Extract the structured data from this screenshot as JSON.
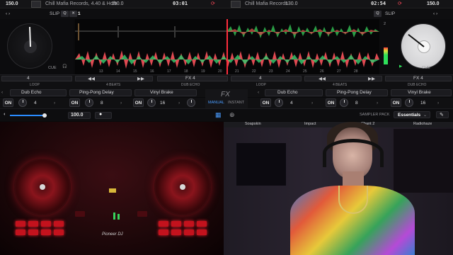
{
  "top_bar": {
    "deck_a": {
      "bpm": "150.0",
      "artist": "Chill Mafia Records, 4.40 & Hofe",
      "key_bpm": "150.0",
      "time": "03:01"
    },
    "deck_b": {
      "bpm": "150.0",
      "artist": "Chill Mafia Records",
      "key_bpm": "130.0",
      "time": "02:54"
    }
  },
  "deck_a": {
    "slip": "SLIP",
    "cue": "CUE",
    "q": "Q",
    "marker": "1"
  },
  "deck_b": {
    "slip": "SLIP",
    "cue": "CUE",
    "q": "Q",
    "marker": "2"
  },
  "waveform_ticks": [
    "13",
    "14",
    "15",
    "16",
    "17",
    "18",
    "19",
    "20",
    "21",
    "22",
    "23",
    "24",
    "25",
    "26",
    "27",
    "28",
    "29",
    "30",
    "31"
  ],
  "transport": {
    "loop_a": "4",
    "fx_a": "FX 4",
    "loop_b": "4",
    "fx_b": "FX 4"
  },
  "fx_header": {
    "loop_left": "LOOP",
    "beats_left": "4 BEATS",
    "echo_left": "DUB ECHO",
    "loop_right": "LOOP",
    "beats_right": "4 BEATS",
    "echo_right": "DUB ECHO"
  },
  "fx_left": [
    {
      "name": "Dub Echo",
      "on": "ON",
      "value": "4"
    },
    {
      "name": "Ping-Pong Delay",
      "on": "ON",
      "value": "8"
    },
    {
      "name": "Vinyl Brake",
      "on": "ON",
      "value": "16"
    }
  ],
  "fx_right": [
    {
      "name": "Dub Echo",
      "on": "ON",
      "value": "4"
    },
    {
      "name": "Ping-Pong Delay",
      "on": "ON",
      "value": "8"
    },
    {
      "name": "Vinyl Brake",
      "on": "ON",
      "value": "16"
    }
  ],
  "fx_center": {
    "title": "FX",
    "manual": "MANUAL",
    "instant": "INSTANT"
  },
  "sampler": {
    "tempo": "100.0",
    "pack_label": "SAMPLER PACK",
    "pack": "Essentials"
  },
  "camera_tabs": [
    "Soapskin",
    "Impact",
    "Chant 2",
    "Radiohaze"
  ],
  "controller": {
    "brand": "Pioneer DJ"
  },
  "colors": {
    "accent": "#2a8cff",
    "playhead": "#ff2d3d",
    "pad": "#c3121d"
  }
}
